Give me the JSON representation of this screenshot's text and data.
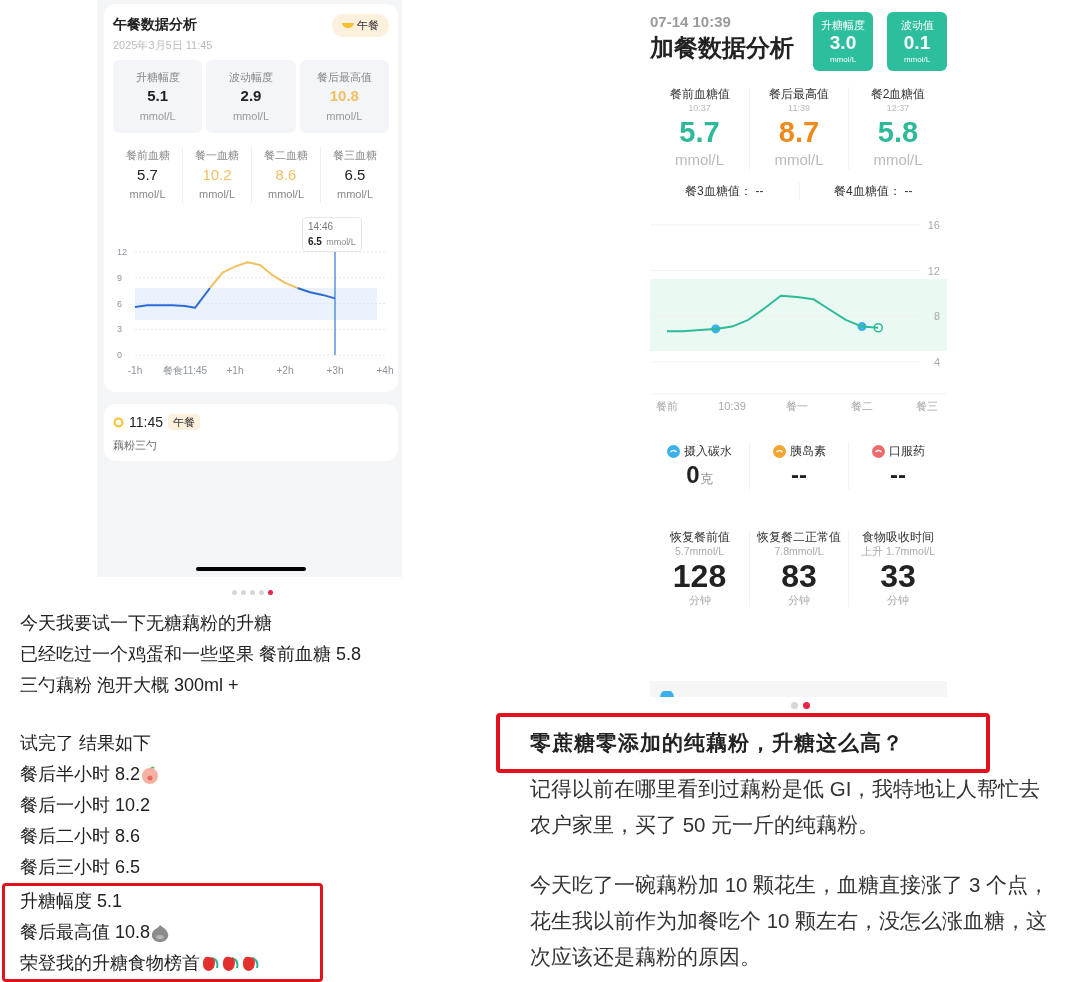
{
  "left_post": {
    "app_screen": {
      "card": {
        "title": "午餐数据分析",
        "meal_badge": "午餐",
        "date": "2025年3月5日 11:45",
        "summary": [
          {
            "label": "升糖幅度",
            "value": "5.1",
            "unit": "mmol/L",
            "high": false
          },
          {
            "label": "波动幅度",
            "value": "2.9",
            "unit": "mmol/L",
            "high": false
          },
          {
            "label": "餐后最高值",
            "value": "10.8",
            "unit": "mmol/L",
            "high": true
          }
        ],
        "readings": [
          {
            "label": "餐前血糖",
            "value": "5.7",
            "unit": "mmol/L",
            "high": false
          },
          {
            "label": "餐一血糖",
            "value": "10.2",
            "unit": "mmol/L",
            "high": true
          },
          {
            "label": "餐二血糖",
            "value": "8.6",
            "unit": "mmol/L",
            "high": true
          },
          {
            "label": "餐三血糖",
            "value": "6.5",
            "unit": "mmol/L",
            "high": false
          }
        ],
        "tooltip": {
          "time": "14:46",
          "value": "6.5",
          "unit": "mmol/L"
        },
        "chart_data": {
          "type": "line",
          "x": [
            -1,
            -0.75,
            -0.5,
            -0.25,
            0,
            0.2,
            0.5,
            0.75,
            1,
            1.25,
            1.5,
            1.75,
            2,
            2.25,
            2.5,
            2.75,
            3
          ],
          "xlim": [
            -1,
            4
          ],
          "ylim": [
            0,
            12
          ],
          "yticks": [
            0,
            3,
            6,
            9,
            12
          ],
          "grid": true,
          "xticks": [
            {
              "value": -1,
              "label": "-1h"
            },
            {
              "value": 0,
              "label": "餐食11:45"
            },
            {
              "value": 1,
              "label": "+1h"
            },
            {
              "value": 2,
              "label": "+2h"
            },
            {
              "value": 3,
              "label": "+3h"
            },
            {
              "value": 4,
              "label": "+4h"
            }
          ],
          "series": [
            {
              "color": "#2f6bd6",
              "values": [
                5.6,
                5.8,
                5.8,
                5.8,
                5.7,
                5.5,
                7.8,
                null,
                null,
                null,
                null,
                null,
                null,
                7.8,
                7.3,
                7.0,
                6.6
              ]
            },
            {
              "color": "#f2c063",
              "values": [
                null,
                null,
                null,
                null,
                null,
                null,
                7.8,
                9.6,
                10.3,
                10.8,
                10.5,
                9.3,
                8.4,
                7.8,
                null,
                null,
                null
              ]
            }
          ],
          "ref_lines": [
            {
              "axis": "x",
              "value": 3
            }
          ]
        }
      },
      "meal_card": {
        "time": "11:45",
        "tag": "午餐",
        "food": "藕粉三勺"
      }
    },
    "pager": [
      {
        "selected": false
      },
      {
        "selected": false
      },
      {
        "selected": false
      },
      {
        "selected": false
      },
      {
        "selected": true
      }
    ],
    "blocks": [
      {
        "boxed": false,
        "lines": [
          {
            "text": "今天我要试一下无糖藕粉的升糖"
          },
          {
            "text": "已经吃过一个鸡蛋和一些坚果 餐前血糖 5.8"
          },
          {
            "text": "三勺藕粉 泡开大概 300ml +"
          }
        ]
      },
      {
        "boxed": false,
        "lines": [
          {
            "text": "试完了 结果如下"
          },
          {
            "text": "餐后半小时 8.2",
            "emojis": [
              {
                "kind": "peach"
              }
            ]
          },
          {
            "text": "餐后一小时 10.2"
          },
          {
            "text": "餐后二小时 8.6"
          },
          {
            "text": "餐后三小时 6.5"
          }
        ]
      },
      {
        "boxed": true,
        "lines": [
          {
            "text": "升糖幅度 5.1"
          },
          {
            "text": "餐后最高值 10.8",
            "emojis": [
              {
                "kind": "blob"
              }
            ]
          },
          {
            "text": "荣登我的升糖食物榜首",
            "emojis": [
              {
                "kind": "tulip"
              },
              {
                "kind": "tulip"
              },
              {
                "kind": "tulip"
              }
            ]
          }
        ]
      }
    ]
  },
  "right_post": {
    "app_screen": {
      "datetime": "07-14 10:39",
      "title": "加餐数据分析",
      "badges": [
        {
          "label": "升糖幅度",
          "value": "3.0",
          "unit": "mmol/L"
        },
        {
          "label": "波动值",
          "value": "0.1",
          "unit": "mmol/L"
        }
      ],
      "stats": [
        {
          "label": "餐前血糖值",
          "time": "10:37",
          "value": "5.7",
          "unit": "mmol/L",
          "high": false
        },
        {
          "label": "餐后最高值",
          "time": "11:39",
          "value": "8.7",
          "unit": "mmol/L",
          "high": true
        },
        {
          "label": "餐2血糖值",
          "time": "12:37",
          "value": "5.8",
          "unit": "mmol/L",
          "high": false
        }
      ],
      "extra": [
        {
          "label": "餐3血糖值：",
          "value": "--"
        },
        {
          "label": "餐4血糖值：",
          "value": "--"
        }
      ],
      "chart_data": {
        "type": "line",
        "categories": [
          "餐前",
          null,
          null,
          null,
          "10:39",
          null,
          null,
          null,
          "餐一",
          null,
          null,
          null,
          "餐二",
          null,
          null,
          null,
          "餐三"
        ],
        "ylim": [
          4,
          16
        ],
        "yticks": [
          4,
          8,
          12,
          16
        ],
        "grid": true,
        "series": [
          {
            "color": "#2dbb9a",
            "values": [
              6.7,
              6.7,
              6.8,
              6.9,
              7.1,
              7.7,
              8.7,
              9.8,
              9.7,
              9.5,
              8.6,
              7.7,
              7.1,
              7.0,
              null,
              null,
              null
            ]
          }
        ]
      },
      "intake": [
        {
          "kind": "carbs",
          "label": "摄入碳水",
          "value": "0",
          "unit": "克"
        },
        {
          "kind": "insulin",
          "label": "胰岛素",
          "value": "--"
        },
        {
          "kind": "medicine",
          "label": "口服药",
          "value": "--"
        }
      ],
      "timings": [
        {
          "label": "恢复餐前值",
          "sub": "5.7mmol/L",
          "value": "128",
          "unit": "分钟"
        },
        {
          "label": "恢复餐二正常值",
          "sub": "7.8mmol/L",
          "value": "83",
          "unit": "分钟"
        },
        {
          "label": "食物吸收时间",
          "sub": "上升 1.7mmol/L",
          "value": "33",
          "unit": "分钟"
        }
      ]
    },
    "pager": [
      {
        "selected": false
      },
      {
        "selected": true
      }
    ],
    "title": "零蔗糖零添加的纯藕粉，升糖这么高？",
    "paragraphs": [
      "记得以前在哪里看到过藕粉是低 GI，我特地让人帮忙去农户家里，买了 50 元一斤的纯藕粉。",
      "今天吃了一碗藕粉加 10 颗花生，血糖直接涨了 3 个点，花生我以前作为加餐吃个 10 颗左右，没怎么涨血糖，这次应该还是藕粉的原因。"
    ]
  }
}
